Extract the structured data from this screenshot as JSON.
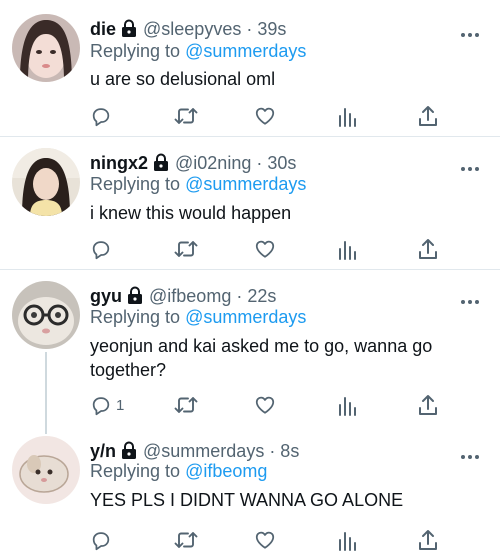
{
  "tweets": [
    {
      "name": "die",
      "handle": "@sleepyves · 39s",
      "reply_prefix": "Replying to ",
      "reply_to": "@summerdays",
      "text": "u are so delusional oml",
      "reply_count": ""
    },
    {
      "name": "ningx2",
      "handle": "@i02ning · 30s",
      "reply_prefix": "Replying to ",
      "reply_to": "@summerdays",
      "text": "i knew this would happen",
      "reply_count": ""
    },
    {
      "name": "gyu",
      "handle": "@ifbeomg · 22s",
      "reply_prefix": "Replying to ",
      "reply_to": "@summerdays",
      "text": "yeonjun and kai asked me to go, wanna go together?",
      "reply_count": "1"
    },
    {
      "name": "y/n",
      "handle": "@summerdays · 8s",
      "reply_prefix": "Replying to ",
      "reply_to": "@ifbeomg",
      "text": "YES PLS I DIDNT WANNA GO ALONE",
      "reply_count": ""
    }
  ],
  "icons": {
    "lock": "lock-icon",
    "more": "more-icon",
    "reply": "reply-icon",
    "retweet": "retweet-icon",
    "like": "heart-icon",
    "views": "views-icon",
    "share": "share-icon"
  },
  "colors": {
    "accent": "#1d9bf0",
    "muted": "#536471",
    "text": "#0f1419",
    "divider": "#e1e8ed"
  }
}
